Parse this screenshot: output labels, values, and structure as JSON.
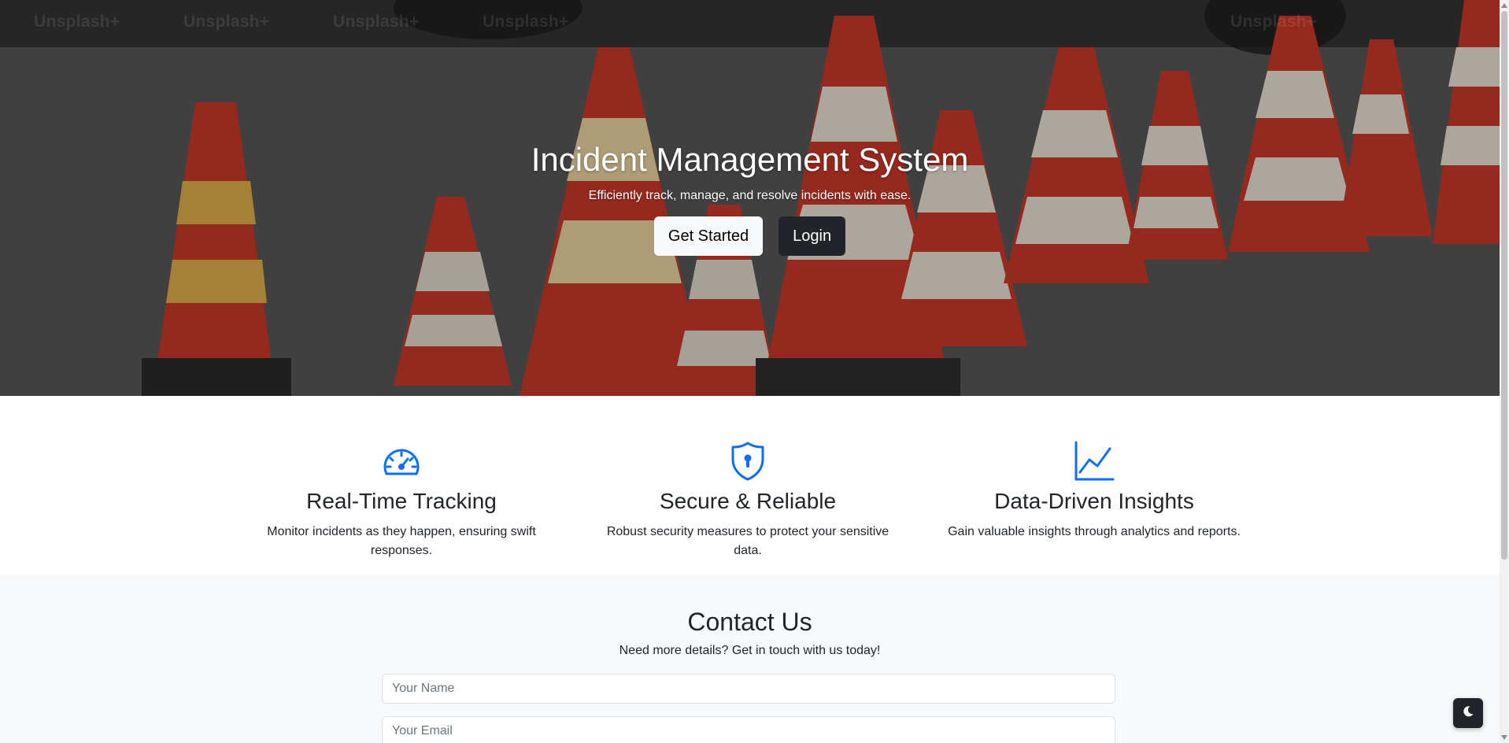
{
  "hero": {
    "watermarks": [
      "Unsplash+",
      "Unsplash+",
      "Unsplash+",
      "Unsplash+",
      "Unsplash+"
    ],
    "title": "Incident Management System",
    "subtitle": "Efficiently track, manage, and resolve incidents with ease.",
    "get_started_label": "Get Started",
    "login_label": "Login"
  },
  "features": [
    {
      "icon": "speedometer-icon",
      "title": "Real-Time Tracking",
      "description": "Monitor incidents as they happen, ensuring swift responses."
    },
    {
      "icon": "shield-lock-icon",
      "title": "Secure & Reliable",
      "description": "Robust security measures to protect your sensitive data."
    },
    {
      "icon": "line-chart-icon",
      "title": "Data-Driven Insights",
      "description": "Gain valuable insights through analytics and reports."
    }
  ],
  "contact": {
    "title": "Contact Us",
    "subtitle": "Need more details? Get in touch with us today!",
    "name_placeholder": "Your Name",
    "email_placeholder": "Your Email"
  },
  "theme_toggle": {
    "icon": "moon-icon"
  },
  "colors": {
    "accent": "#0d6efd",
    "dark": "#212529",
    "light": "#f8f9fa",
    "cone_orange": "#e0442e",
    "cone_stripe": "#f0e6d8"
  }
}
